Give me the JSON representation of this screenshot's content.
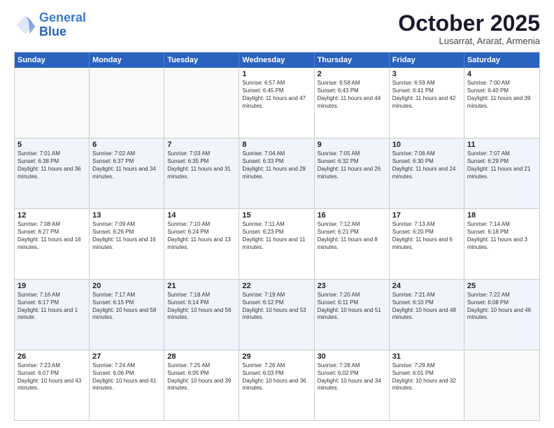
{
  "logo": {
    "line1": "General",
    "line2": "Blue"
  },
  "title": "October 2025",
  "subtitle": "Lusarrat, Ararat, Armenia",
  "headers": [
    "Sunday",
    "Monday",
    "Tuesday",
    "Wednesday",
    "Thursday",
    "Friday",
    "Saturday"
  ],
  "rows": [
    [
      {
        "day": "",
        "text": ""
      },
      {
        "day": "",
        "text": ""
      },
      {
        "day": "",
        "text": ""
      },
      {
        "day": "1",
        "text": "Sunrise: 6:57 AM\nSunset: 6:45 PM\nDaylight: 11 hours and 47 minutes."
      },
      {
        "day": "2",
        "text": "Sunrise: 6:58 AM\nSunset: 6:43 PM\nDaylight: 11 hours and 44 minutes."
      },
      {
        "day": "3",
        "text": "Sunrise: 6:59 AM\nSunset: 6:41 PM\nDaylight: 11 hours and 42 minutes."
      },
      {
        "day": "4",
        "text": "Sunrise: 7:00 AM\nSunset: 6:40 PM\nDaylight: 11 hours and 39 minutes."
      }
    ],
    [
      {
        "day": "5",
        "text": "Sunrise: 7:01 AM\nSunset: 6:38 PM\nDaylight: 11 hours and 36 minutes."
      },
      {
        "day": "6",
        "text": "Sunrise: 7:02 AM\nSunset: 6:37 PM\nDaylight: 11 hours and 34 minutes."
      },
      {
        "day": "7",
        "text": "Sunrise: 7:03 AM\nSunset: 6:35 PM\nDaylight: 11 hours and 31 minutes."
      },
      {
        "day": "8",
        "text": "Sunrise: 7:04 AM\nSunset: 6:33 PM\nDaylight: 11 hours and 29 minutes."
      },
      {
        "day": "9",
        "text": "Sunrise: 7:05 AM\nSunset: 6:32 PM\nDaylight: 11 hours and 26 minutes."
      },
      {
        "day": "10",
        "text": "Sunrise: 7:06 AM\nSunset: 6:30 PM\nDaylight: 11 hours and 24 minutes."
      },
      {
        "day": "11",
        "text": "Sunrise: 7:07 AM\nSunset: 6:29 PM\nDaylight: 11 hours and 21 minutes."
      }
    ],
    [
      {
        "day": "12",
        "text": "Sunrise: 7:08 AM\nSunset: 6:27 PM\nDaylight: 11 hours and 18 minutes."
      },
      {
        "day": "13",
        "text": "Sunrise: 7:09 AM\nSunset: 6:26 PM\nDaylight: 11 hours and 16 minutes."
      },
      {
        "day": "14",
        "text": "Sunrise: 7:10 AM\nSunset: 6:24 PM\nDaylight: 11 hours and 13 minutes."
      },
      {
        "day": "15",
        "text": "Sunrise: 7:11 AM\nSunset: 6:23 PM\nDaylight: 11 hours and 11 minutes."
      },
      {
        "day": "16",
        "text": "Sunrise: 7:12 AM\nSunset: 6:21 PM\nDaylight: 11 hours and 8 minutes."
      },
      {
        "day": "17",
        "text": "Sunrise: 7:13 AM\nSunset: 6:20 PM\nDaylight: 11 hours and 6 minutes."
      },
      {
        "day": "18",
        "text": "Sunrise: 7:14 AM\nSunset: 6:18 PM\nDaylight: 11 hours and 3 minutes."
      }
    ],
    [
      {
        "day": "19",
        "text": "Sunrise: 7:16 AM\nSunset: 6:17 PM\nDaylight: 11 hours and 1 minute."
      },
      {
        "day": "20",
        "text": "Sunrise: 7:17 AM\nSunset: 6:15 PM\nDaylight: 10 hours and 58 minutes."
      },
      {
        "day": "21",
        "text": "Sunrise: 7:18 AM\nSunset: 6:14 PM\nDaylight: 10 hours and 56 minutes."
      },
      {
        "day": "22",
        "text": "Sunrise: 7:19 AM\nSunset: 6:12 PM\nDaylight: 10 hours and 53 minutes."
      },
      {
        "day": "23",
        "text": "Sunrise: 7:20 AM\nSunset: 6:11 PM\nDaylight: 10 hours and 51 minutes."
      },
      {
        "day": "24",
        "text": "Sunrise: 7:21 AM\nSunset: 6:10 PM\nDaylight: 10 hours and 48 minutes."
      },
      {
        "day": "25",
        "text": "Sunrise: 7:22 AM\nSunset: 6:08 PM\nDaylight: 10 hours and 46 minutes."
      }
    ],
    [
      {
        "day": "26",
        "text": "Sunrise: 7:23 AM\nSunset: 6:07 PM\nDaylight: 10 hours and 43 minutes."
      },
      {
        "day": "27",
        "text": "Sunrise: 7:24 AM\nSunset: 6:06 PM\nDaylight: 10 hours and 41 minutes."
      },
      {
        "day": "28",
        "text": "Sunrise: 7:25 AM\nSunset: 6:05 PM\nDaylight: 10 hours and 39 minutes."
      },
      {
        "day": "29",
        "text": "Sunrise: 7:26 AM\nSunset: 6:03 PM\nDaylight: 10 hours and 36 minutes."
      },
      {
        "day": "30",
        "text": "Sunrise: 7:28 AM\nSunset: 6:02 PM\nDaylight: 10 hours and 34 minutes."
      },
      {
        "day": "31",
        "text": "Sunrise: 7:29 AM\nSunset: 6:01 PM\nDaylight: 10 hours and 32 minutes."
      },
      {
        "day": "",
        "text": ""
      }
    ]
  ]
}
